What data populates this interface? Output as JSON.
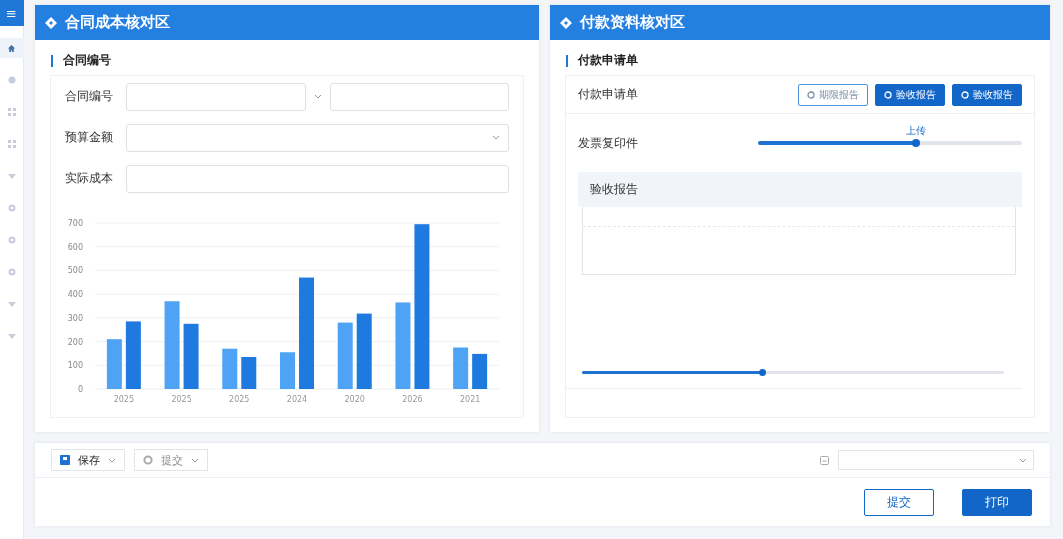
{
  "sidebar": {
    "menu_glyph": "≡",
    "items": [
      {
        "kind": "home",
        "selected": true
      },
      {
        "kind": "circle",
        "selected": false
      },
      {
        "kind": "grid",
        "selected": false
      },
      {
        "kind": "grid",
        "selected": false
      },
      {
        "kind": "caret",
        "selected": false
      },
      {
        "kind": "gear",
        "selected": false
      },
      {
        "kind": "gear",
        "selected": false
      },
      {
        "kind": "gear",
        "selected": false
      },
      {
        "kind": "caret",
        "selected": false
      },
      {
        "kind": "caret",
        "selected": false
      }
    ]
  },
  "left_panel": {
    "title": "合同成本核对区",
    "section": "合同编号",
    "fields": [
      {
        "label": "合同编号",
        "kind": "split"
      },
      {
        "label": "预算金额",
        "kind": "select"
      },
      {
        "label": "实际成本",
        "kind": "text"
      }
    ],
    "chart_data": {
      "type": "bar",
      "categories": [
        "2025",
        "2025",
        "2025",
        "2024",
        "2020",
        "2026",
        "2021"
      ],
      "yticks": [
        0,
        100,
        200,
        300,
        400,
        500,
        600,
        700
      ],
      "ylim": [
        0,
        700
      ],
      "grid": true,
      "stacked": false,
      "series": [
        {
          "color": "#4fa3f5",
          "values": [
            210,
            370,
            170,
            155,
            280,
            365,
            175
          ]
        },
        {
          "color": "#1f7ae0",
          "values": [
            285,
            275,
            135,
            470,
            318,
            695,
            148
          ]
        }
      ]
    }
  },
  "right_panel": {
    "title": "付款资料核对区",
    "section": "付款申请单",
    "row_label": "付款申请单",
    "buttons": [
      {
        "label": "期限报告",
        "kind": "outline"
      },
      {
        "label": "验收报告",
        "kind": "solid"
      },
      {
        "label": "验收报告",
        "kind": "solid"
      }
    ],
    "invoice": {
      "label": "发票复印件",
      "caption": "上传",
      "level": 0.6
    },
    "report": {
      "label": "验收报告"
    },
    "bottom_slider": {
      "level": 0.43
    }
  },
  "footer": {
    "save": "保存",
    "submit_menu": "提交",
    "submit": "提交",
    "print": "打印"
  }
}
